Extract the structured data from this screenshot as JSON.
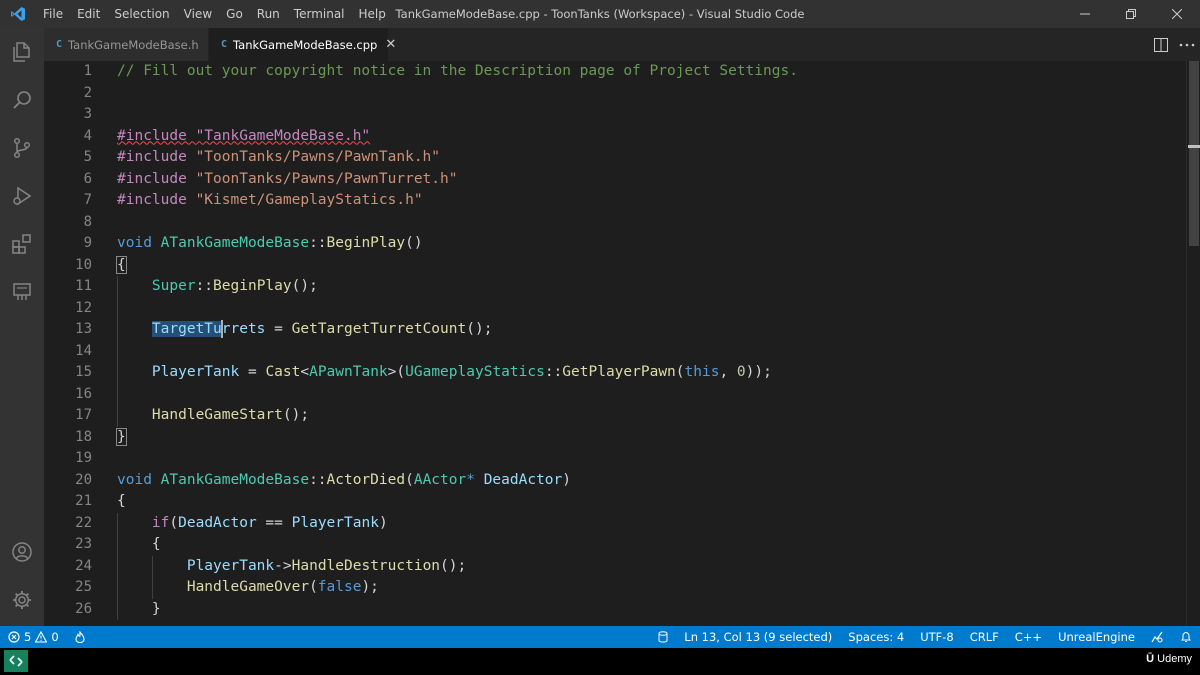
{
  "window": {
    "title": "TankGameModeBase.cpp - ToonTanks (Workspace) - Visual Studio Code",
    "menu": [
      "File",
      "Edit",
      "Selection",
      "View",
      "Go",
      "Run",
      "Terminal",
      "Help"
    ]
  },
  "activity_bar": {
    "top": [
      "explorer-icon",
      "search-icon",
      "source-control-icon",
      "run-debug-icon",
      "extensions-icon",
      "remote-explorer-icon"
    ],
    "bottom": [
      "account-icon",
      "settings-gear-icon"
    ]
  },
  "tabs": [
    {
      "label": "TankGameModeBase.h",
      "icon": "C",
      "active": false
    },
    {
      "label": "TankGameModeBase.cpp",
      "icon": "C",
      "active": true,
      "close": "✕"
    }
  ],
  "editor": {
    "line_numbers": [
      "1",
      "2",
      "3",
      "4",
      "5",
      "6",
      "7",
      "8",
      "9",
      "10",
      "11",
      "12",
      "13",
      "14",
      "15",
      "16",
      "17",
      "18",
      "19",
      "20",
      "21",
      "22",
      "23",
      "24",
      "25",
      "26"
    ],
    "lines": [
      {
        "tokens": [
          {
            "t": "// Fill out your copyright notice in the Description page of Project Settings.",
            "c": "comment"
          }
        ]
      },
      {
        "tokens": []
      },
      {
        "tokens": []
      },
      {
        "tokens": [
          {
            "t": "#include \"TankGameModeBase.h\"",
            "c": "pp",
            "squiggle": true
          }
        ]
      },
      {
        "tokens": [
          {
            "t": "#include ",
            "c": "pp"
          },
          {
            "t": "\"ToonTanks/Pawns/PawnTank.h\"",
            "c": "str"
          }
        ]
      },
      {
        "tokens": [
          {
            "t": "#include ",
            "c": "pp"
          },
          {
            "t": "\"ToonTanks/Pawns/PawnTurret.h\"",
            "c": "str"
          }
        ]
      },
      {
        "tokens": [
          {
            "t": "#include ",
            "c": "pp"
          },
          {
            "t": "\"Kismet/GameplayStatics.h\"",
            "c": "str"
          }
        ]
      },
      {
        "tokens": []
      },
      {
        "tokens": [
          {
            "t": "void",
            "c": "kw"
          },
          {
            "t": " ",
            "c": "plain"
          },
          {
            "t": "ATankGameModeBase",
            "c": "type"
          },
          {
            "t": "::",
            "c": "plain"
          },
          {
            "t": "BeginPlay",
            "c": "fn"
          },
          {
            "t": "()",
            "c": "plain"
          }
        ]
      },
      {
        "tokens": [
          {
            "t": "{",
            "c": "plain",
            "box": true
          }
        ]
      },
      {
        "indent": 1,
        "tokens": [
          {
            "t": "    ",
            "c": "plain"
          },
          {
            "t": "Super",
            "c": "type"
          },
          {
            "t": "::",
            "c": "plain"
          },
          {
            "t": "BeginPlay",
            "c": "fn"
          },
          {
            "t": "();",
            "c": "plain"
          }
        ]
      },
      {
        "indent": 1,
        "tokens": []
      },
      {
        "indent": 1,
        "tokens": [
          {
            "t": "    ",
            "c": "plain"
          },
          {
            "t": "TargetTu",
            "c": "var",
            "sel": true
          },
          {
            "t": "",
            "c": "plain",
            "cursor": true
          },
          {
            "t": "rrets",
            "c": "var"
          },
          {
            "t": " = ",
            "c": "plain"
          },
          {
            "t": "GetTargetTurretCount",
            "c": "fn"
          },
          {
            "t": "();",
            "c": "plain"
          }
        ]
      },
      {
        "indent": 1,
        "tokens": []
      },
      {
        "indent": 1,
        "tokens": [
          {
            "t": "    ",
            "c": "plain"
          },
          {
            "t": "PlayerTank",
            "c": "var"
          },
          {
            "t": " = ",
            "c": "plain"
          },
          {
            "t": "Cast",
            "c": "fn"
          },
          {
            "t": "<",
            "c": "plain"
          },
          {
            "t": "APawnTank",
            "c": "type"
          },
          {
            "t": ">(",
            "c": "plain"
          },
          {
            "t": "UGameplayStatics",
            "c": "type"
          },
          {
            "t": "::",
            "c": "plain"
          },
          {
            "t": "GetPlayerPawn",
            "c": "fn"
          },
          {
            "t": "(",
            "c": "plain"
          },
          {
            "t": "this",
            "c": "kw"
          },
          {
            "t": ", ",
            "c": "plain"
          },
          {
            "t": "0",
            "c": "num"
          },
          {
            "t": "));",
            "c": "plain"
          }
        ]
      },
      {
        "indent": 1,
        "tokens": []
      },
      {
        "indent": 1,
        "tokens": [
          {
            "t": "    ",
            "c": "plain"
          },
          {
            "t": "HandleGameStart",
            "c": "fn"
          },
          {
            "t": "();",
            "c": "plain"
          }
        ]
      },
      {
        "tokens": [
          {
            "t": "}",
            "c": "plain",
            "box": true
          }
        ]
      },
      {
        "tokens": []
      },
      {
        "tokens": [
          {
            "t": "void",
            "c": "kw"
          },
          {
            "t": " ",
            "c": "plain"
          },
          {
            "t": "ATankGameModeBase",
            "c": "type"
          },
          {
            "t": "::",
            "c": "plain"
          },
          {
            "t": "ActorDied",
            "c": "fn"
          },
          {
            "t": "(",
            "c": "plain"
          },
          {
            "t": "AActor",
            "c": "type"
          },
          {
            "t": "* ",
            "c": "kw"
          },
          {
            "t": "DeadActor",
            "c": "var"
          },
          {
            "t": ")",
            "c": "plain"
          }
        ]
      },
      {
        "tokens": [
          {
            "t": "{",
            "c": "plain"
          }
        ]
      },
      {
        "indent": 1,
        "tokens": [
          {
            "t": "    ",
            "c": "plain"
          },
          {
            "t": "if",
            "c": "pp"
          },
          {
            "t": "(",
            "c": "plain"
          },
          {
            "t": "DeadActor",
            "c": "var"
          },
          {
            "t": " == ",
            "c": "plain"
          },
          {
            "t": "PlayerTank",
            "c": "var"
          },
          {
            "t": ")",
            "c": "plain"
          }
        ]
      },
      {
        "indent": 1,
        "tokens": [
          {
            "t": "    {",
            "c": "plain"
          }
        ]
      },
      {
        "indent": 2,
        "tokens": [
          {
            "t": "        ",
            "c": "plain"
          },
          {
            "t": "PlayerTank",
            "c": "var"
          },
          {
            "t": "->",
            "c": "plain"
          },
          {
            "t": "HandleDestruction",
            "c": "fn"
          },
          {
            "t": "();",
            "c": "plain"
          }
        ]
      },
      {
        "indent": 2,
        "tokens": [
          {
            "t": "        ",
            "c": "plain"
          },
          {
            "t": "HandleGameOver",
            "c": "fn"
          },
          {
            "t": "(",
            "c": "plain"
          },
          {
            "t": "false",
            "c": "kw"
          },
          {
            "t": ");",
            "c": "plain"
          }
        ]
      },
      {
        "indent": 1,
        "tokens": [
          {
            "t": "    }",
            "c": "plain"
          }
        ]
      }
    ]
  },
  "status_bar": {
    "errors": "5",
    "warnings": "0",
    "position": "Ln 13, Col 13 (9 selected)",
    "spaces": "Spaces: 4",
    "encoding": "UTF-8",
    "eol": "CRLF",
    "language": "C++",
    "config": "UnrealEngine"
  },
  "bottom": {
    "brand": "Udemy"
  },
  "colors": {
    "accent": "#007acc",
    "editor_bg": "#1e1e1e"
  }
}
